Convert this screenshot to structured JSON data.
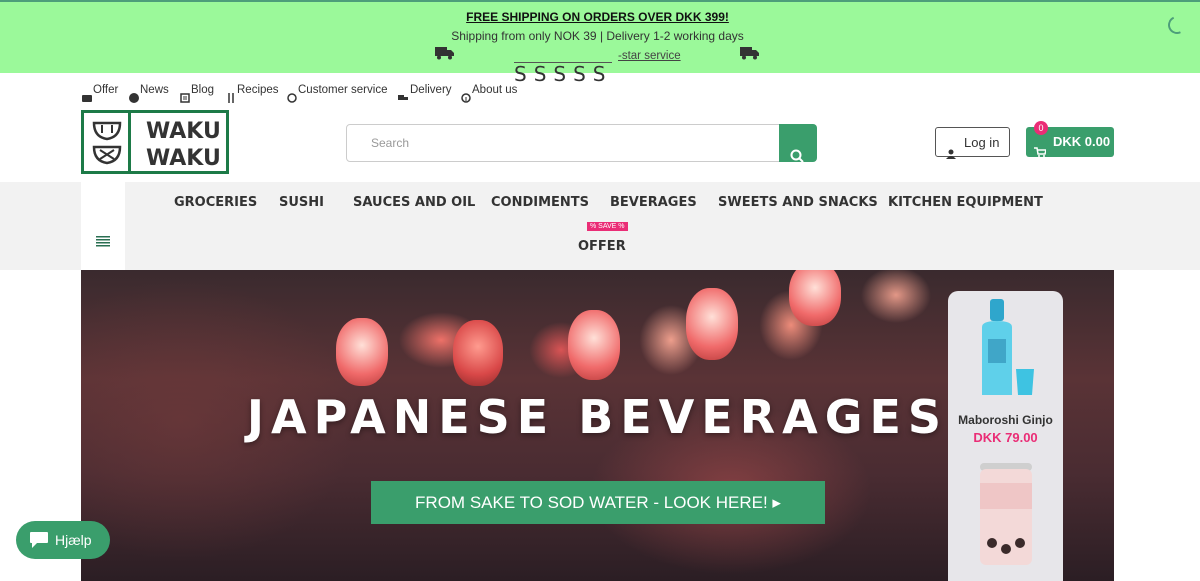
{
  "announcement": {
    "headline": "FREE SHIPPING ON ORDERS OVER DKK 399!",
    "shipping_info": "Shipping from only NOK 39 | Delivery 1-2 working days",
    "service_link": "-star service",
    "stars": "SSSSS"
  },
  "utility_nav": [
    {
      "label": "Offer",
      "icon": "offer-icon"
    },
    {
      "label": "News",
      "icon": "news-icon"
    },
    {
      "label": "Blog",
      "icon": "blog-icon"
    },
    {
      "label": "Recipes",
      "icon": "recipes-icon"
    },
    {
      "label": "Customer service",
      "icon": "customer-service-icon"
    },
    {
      "label": "Delivery",
      "icon": "delivery-icon"
    },
    {
      "label": "About us",
      "icon": "about-icon"
    }
  ],
  "logo": {
    "line1": "WAKU",
    "line2": "WAKU"
  },
  "search": {
    "placeholder": "Search"
  },
  "account": {
    "login_label": "Log in"
  },
  "cart": {
    "count": "0",
    "total": "DKK 0.00"
  },
  "main_nav": {
    "items": [
      "GROCERIES",
      "SUSHI",
      "SAUCES AND OIL",
      "CONDIMENTS",
      "BEVERAGES",
      "SWEETS AND SNACKS",
      "KITCHEN EQUIPMENT"
    ],
    "offer_badge": "% SAVE %",
    "offer_label": "OFFER"
  },
  "hero": {
    "title": "JAPANESE BEVERAGES",
    "cta": "FROM SAKE TO SOD WATER - LOOK HERE! ▸"
  },
  "featured_product": {
    "name": "Maboroshi Ginjo",
    "price": "DKK 79.00"
  },
  "help_widget": {
    "label": "Hjælp"
  },
  "colors": {
    "accent_green": "#3a9e6c",
    "banner_green": "#9bf99a",
    "sale_pink": "#ea2d76",
    "logo_green": "#1d7a47"
  }
}
